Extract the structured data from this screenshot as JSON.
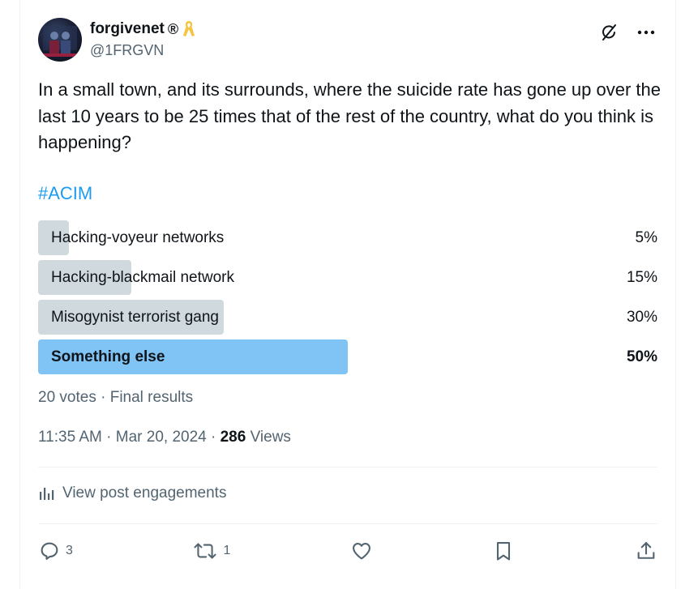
{
  "post": {
    "author": {
      "display_name": "forgivenet",
      "registered_mark": "®",
      "handle": "@1FRGVN",
      "badge_icon": "yellow-ribbon-icon"
    },
    "text": "In a small town, and its surrounds, where the suicide rate has gone up over the last 10 years to be 25 times that of the rest of the country, what do you think is happening?",
    "hashtag": "#ACIM",
    "poll": {
      "options": [
        {
          "label": "Hacking-voyeur networks",
          "percent_label": "5%",
          "percent": 5,
          "winner": false
        },
        {
          "label": "Hacking-blackmail network",
          "percent_label": "15%",
          "percent": 15,
          "winner": false
        },
        {
          "label": "Misogynist terrorist gang",
          "percent_label": "30%",
          "percent": 30,
          "winner": false
        },
        {
          "label": "Something else",
          "percent_label": "50%",
          "percent": 50,
          "winner": true
        }
      ],
      "meta": "20 votes · Final results"
    },
    "time": "11:35 AM · Mar 20, 2024 · ",
    "views_count": "286",
    "views_label": " Views",
    "engagements_label": "View post engagements",
    "stats": {
      "replies": "3",
      "reposts": "1"
    }
  },
  "colors": {
    "accent": "#1d9bf0",
    "bar_default": "#cfd9de",
    "bar_winner": "#80c4f5",
    "secondary_text": "#536471"
  }
}
